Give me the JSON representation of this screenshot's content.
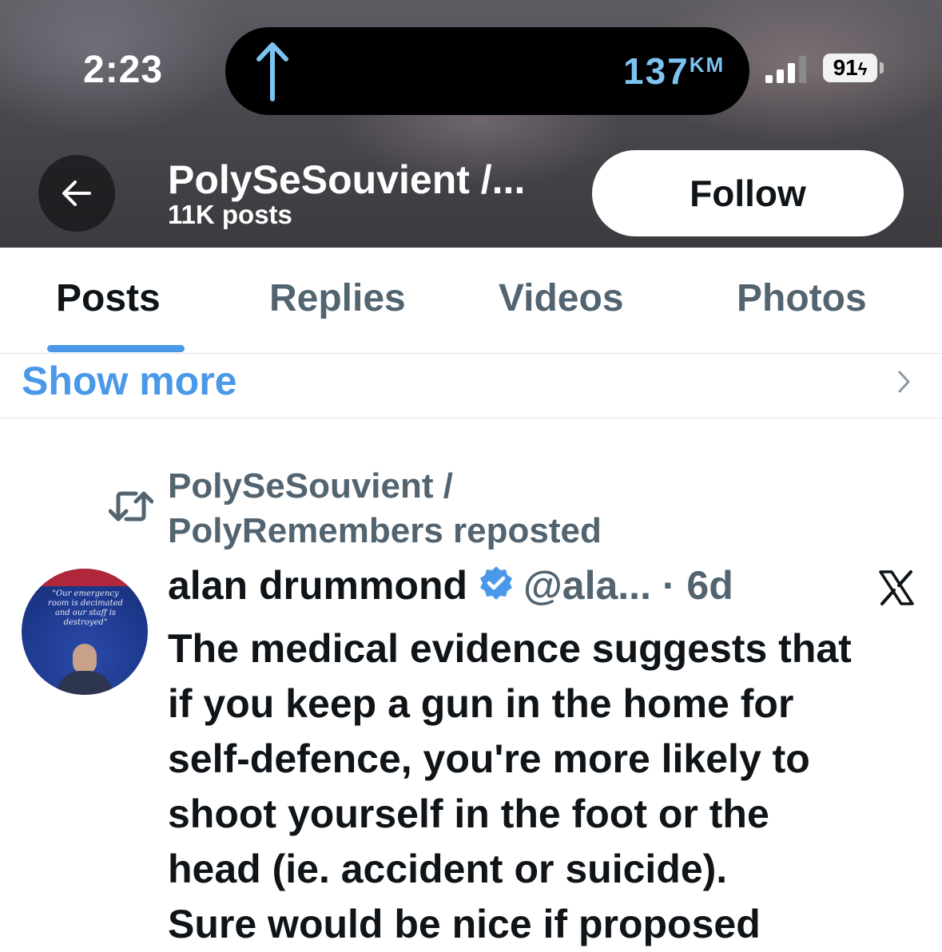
{
  "status_bar": {
    "time": "2:23",
    "nav_distance": "137",
    "nav_unit": "KM",
    "battery_level": "91",
    "icons": [
      "navigation-arrow-icon",
      "cellular-signal-icon",
      "battery-icon"
    ],
    "accent_color": "#7cc3f2"
  },
  "header": {
    "profile_name": "PolySeSouvient /...",
    "post_count": "11K posts",
    "follow_label": "Follow",
    "back_icon": "arrow-left-icon"
  },
  "tabs": [
    {
      "label": "Posts",
      "active": true
    },
    {
      "label": "Replies",
      "active": false
    },
    {
      "label": "Videos",
      "active": false
    },
    {
      "label": "Photos",
      "active": false
    }
  ],
  "show_more": {
    "label": "Show more",
    "icon": "chevron-right-icon",
    "color": "#4a99e9"
  },
  "post": {
    "repost_line_1": "PolySeSouvient /",
    "repost_line_2": "PolyRemembers reposted",
    "avatar_quote": "\"Our emergency room is decimated and our staff is destroyed\"",
    "author_name": "alan drummond",
    "handle_time": "@ala... · 6d",
    "verified_color": "#4a99e9",
    "platform_icon": "x-logo-icon",
    "text_lines": [
      "The medical evidence suggests that",
      "if you keep a gun in the home for",
      "self-defence, you're more likely to",
      "shoot yourself in the foot or the",
      "head (ie. accident or suicide).",
      "Sure would be nice if proposed"
    ]
  }
}
